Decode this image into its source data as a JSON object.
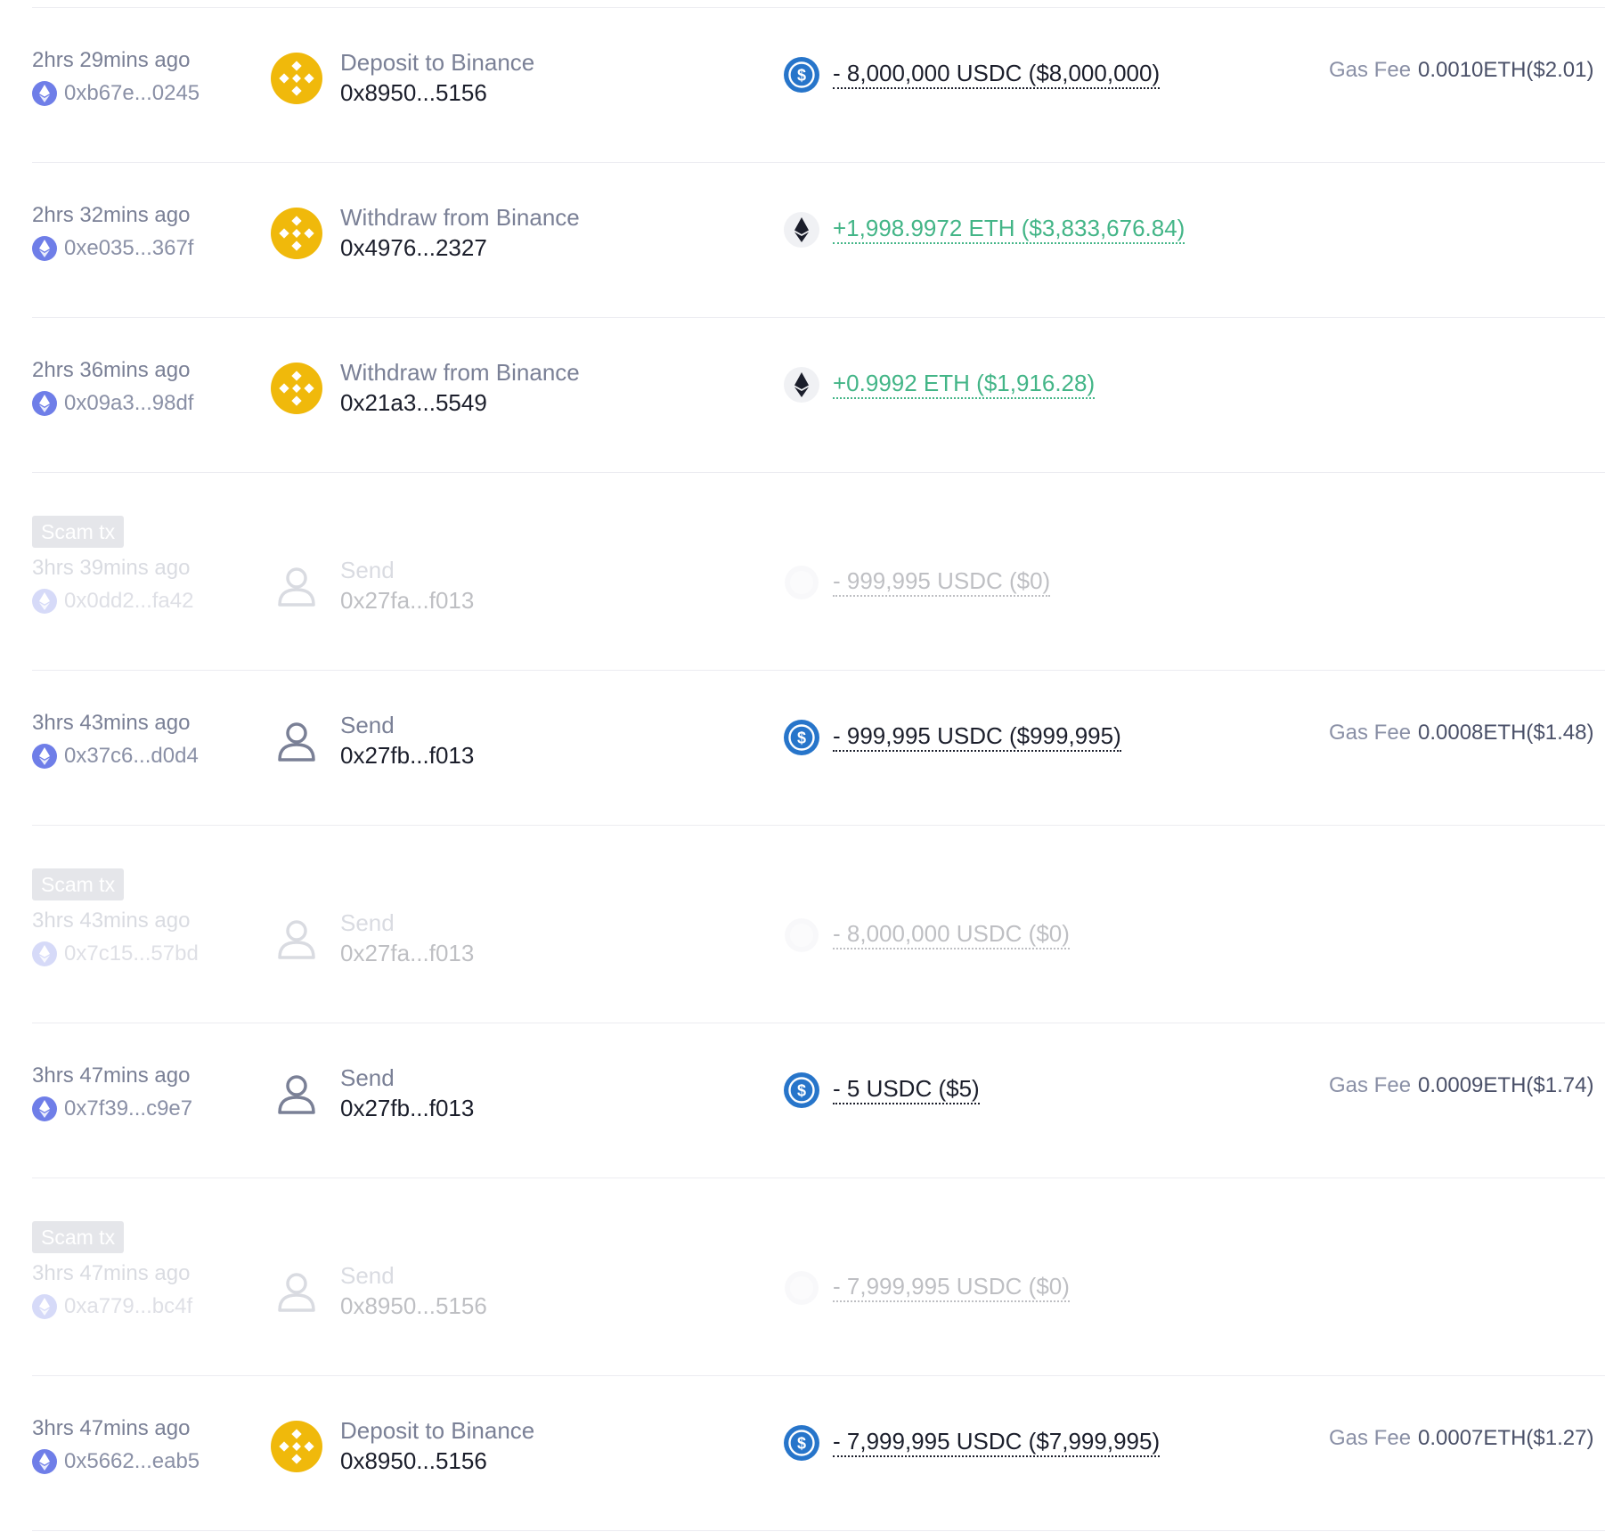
{
  "colors": {
    "positive": "#43b587",
    "negative": "#1b1e2b",
    "binance": "#f0b90b",
    "usdc": "#2775ca",
    "eth_badge": "#6f7ee8",
    "scam_badge": "#e5e6ea"
  },
  "transactions": [
    {
      "time": "2hrs 29mins ago",
      "hash": "0xb67e...0245",
      "method_icon": "binance-icon",
      "method": "Deposit to Binance",
      "address": "0x8950...5156",
      "token_icon": "usdc-icon",
      "amount": "- 8,000,000 USDC ($8,000,000)",
      "gas_label": "Gas Fee",
      "gas_value": "0.0010ETH($2.01)"
    },
    {
      "time": "2hrs 32mins ago",
      "hash": "0xe035...367f",
      "method_icon": "binance-icon",
      "method": "Withdraw from Binance",
      "address": "0x4976...2327",
      "token_icon": "eth-icon",
      "amount": "+1,998.9972 ETH ($3,833,676.84)"
    },
    {
      "time": "2hrs 36mins ago",
      "hash": "0x09a3...98df",
      "method_icon": "binance-icon",
      "method": "Withdraw from Binance",
      "address": "0x21a3...5549",
      "token_icon": "eth-icon",
      "amount": "+0.9992 ETH ($1,916.28)"
    },
    {
      "scam_badge": "Scam tx",
      "time": "3hrs 39mins ago",
      "hash": "0x0dd2...fa42",
      "method_icon": "user-icon",
      "method": "Send",
      "address": "0x27fa...f013",
      "token_icon": "unknown-token-icon",
      "amount": "- 999,995 USDC ($0)"
    },
    {
      "time": "3hrs 43mins ago",
      "hash": "0x37c6...d0d4",
      "method_icon": "user-icon",
      "method": "Send",
      "address": "0x27fb...f013",
      "token_icon": "usdc-icon",
      "amount": "- 999,995 USDC ($999,995)",
      "gas_label": "Gas Fee",
      "gas_value": "0.0008ETH($1.48)"
    },
    {
      "scam_badge": "Scam tx",
      "time": "3hrs 43mins ago",
      "hash": "0x7c15...57bd",
      "method_icon": "user-icon",
      "method": "Send",
      "address": "0x27fa...f013",
      "token_icon": "unknown-token-icon",
      "amount": "- 8,000,000 USDC ($0)"
    },
    {
      "time": "3hrs 47mins ago",
      "hash": "0x7f39...c9e7",
      "method_icon": "user-icon",
      "method": "Send",
      "address": "0x27fb...f013",
      "token_icon": "usdc-icon",
      "amount": "- 5 USDC ($5)",
      "gas_label": "Gas Fee",
      "gas_value": "0.0009ETH($1.74)"
    },
    {
      "scam_badge": "Scam tx",
      "time": "3hrs 47mins ago",
      "hash": "0xa779...bc4f",
      "method_icon": "user-icon",
      "method": "Send",
      "address": "0x8950...5156",
      "token_icon": "unknown-token-icon",
      "amount": "- 7,999,995 USDC ($0)"
    },
    {
      "time": "3hrs 47mins ago",
      "hash": "0x5662...eab5",
      "method_icon": "binance-icon",
      "method": "Deposit to Binance",
      "address": "0x8950...5156",
      "token_icon": "usdc-icon",
      "amount": "- 7,999,995 USDC ($7,999,995)",
      "gas_label": "Gas Fee",
      "gas_value": "0.0007ETH($1.27)"
    }
  ]
}
